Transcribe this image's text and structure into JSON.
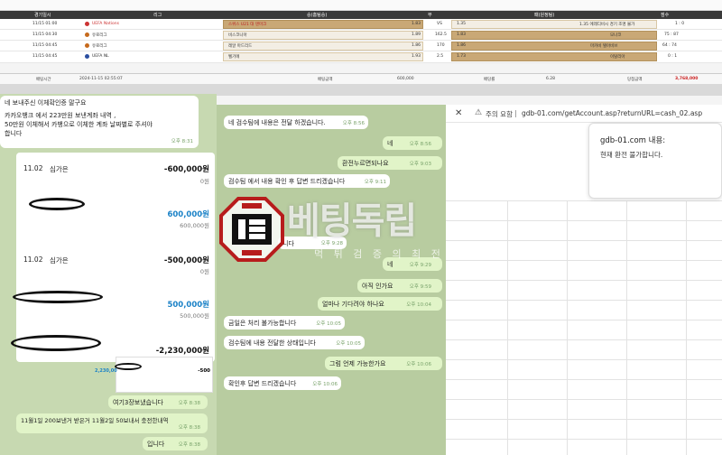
{
  "bet_table": {
    "header": {
      "match_date": "경기일시",
      "league": "리그",
      "home_win": "승(홈팀승)",
      "draw": "무",
      "away_win": "패(원정팀)",
      "score": "점수"
    },
    "rows": [
      {
        "date": "11/15 01:00",
        "league": "UEFA Nations",
        "team_home": "스위스 U21 대 덴마크",
        "odds_home": "1.83",
        "draw": "VS",
        "odds_away": "1.35",
        "team_away": "1.35 에레디비시 경기 조명 불가",
        "score": "1 : 0"
      },
      {
        "date": "11/15 04:30",
        "league": "유로리그",
        "team_home": "비스코니아",
        "odds_home": "1.89",
        "draw": "162.5",
        "odds_away": "1.83",
        "team_away": "모나코",
        "score": "75 : 87"
      },
      {
        "date": "11/15 04:45",
        "league": "유로리그",
        "team_home": "레알 마드리드",
        "odds_home": "1.86",
        "draw": "170",
        "odds_away": "1.86",
        "team_away": "마카비 텔아비브",
        "score": "64 : 74"
      },
      {
        "date": "11/15 04:45",
        "league": "UEFA NL",
        "team_home": "벨기에",
        "odds_home": "1.93",
        "draw": "2.5",
        "odds_away": "1.73",
        "team_away": "이탈리아",
        "score": "0 : 1"
      }
    ],
    "footer": {
      "bet_time_label": "배팅시간",
      "bet_time": "2024-11-15 02:55:07",
      "bet_amount_label": "배팅금액",
      "bet_amount": "600,000",
      "odds_label": "배당률",
      "odds": "6.28",
      "win_label": "당첨금액",
      "win_amount": "3,768,000"
    }
  },
  "left_chat": {
    "msg1_title": "네 보내주신 이체확인증 말구요",
    "msg1_body1": "카카오뱅크 에서 223만원 보낸계좌 내역 ,",
    "msg1_body2": "50만원 이체해서 카뱅으로 이체한 계좌 날짜별로 주셔야",
    "msg1_body3": "합니다",
    "msg1_time": "오후 8:31",
    "tx1_date": "11.02",
    "tx1_name": "심가은",
    "tx1_amount": "-600,000원",
    "tx1_balance": "0원",
    "tx2_amount": "600,000원",
    "tx2_balance": "600,000원",
    "tx3_date": "11.02",
    "tx3_name": "심가은",
    "tx3_amount": "-500,000원",
    "tx3_balance": "0원",
    "tx4_amount": "500,000원",
    "tx4_balance": "500,000원",
    "tx5_amount": "-2,230,000원",
    "mini_amount": "2,230,00",
    "mini_neg": "-500",
    "msg2": "여기3장보냈습니다",
    "msg2_time": "오후 8:38",
    "msg3": "11월1일 200보낸거 받은거 11월2일 50보내서 충전한내역",
    "msg3_time": "오후 8:38",
    "msg4": "입니다",
    "msg4_time": "오후 8:38"
  },
  "mid_chat": {
    "m1": "네 검수팀에 내용은 전달 하겠습니다.",
    "m1_time": "오후 8:56",
    "m2": "네",
    "m2_time": "오후 8:56",
    "m3": "환전누르면되나요",
    "m3_time": "오후 9:03",
    "m4": "검수팀 에서 내용 확인 후 답변 드리겠습니다",
    "m4_time": "오후 9:11",
    "m5": "니다",
    "m5_time": "오후 9:28",
    "m6": "네",
    "m6_time": "오후 9:29",
    "m7": "아직 인가요",
    "m7_time": "오후 9:59",
    "m8": "얼마나 기다려야 하나요",
    "m8_time": "오후 10:04",
    "m9": "금일은 처리 불가능합니다",
    "m9_time": "오후 10:05",
    "m10": "검수팀에 내용 전달한 상태입니다",
    "m10_time": "오후 10:05",
    "m11": "그럼 언제 가능한가요",
    "m11_time": "오후 10:06",
    "m12": "확인후 답변 드리겠습니다",
    "m12_time": "오후 10:06"
  },
  "watermark": {
    "title": "베팅독립",
    "subtitle": "먹 튀 검 증 의  최 전 선"
  },
  "browser": {
    "security_label": "주의 요함",
    "url": "gdb-01.com/getAccount.asp?returnURL=cash_02.asp",
    "dialog_title": "gdb-01.com 내용:",
    "dialog_message": "현재 환전 불가합니다."
  }
}
